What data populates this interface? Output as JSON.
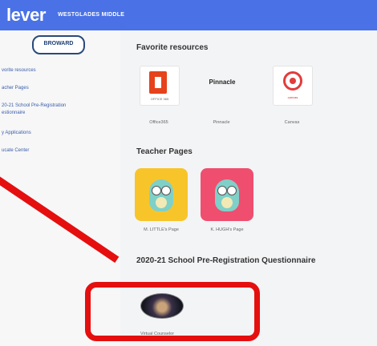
{
  "header": {
    "brand": "lever",
    "school": "WESTGLADES MIDDLE"
  },
  "sidebar": {
    "district_logo": "BROWARD",
    "items": [
      {
        "label": "vorite resources"
      },
      {
        "label": "acher Pages"
      },
      {
        "label": "20-21 School Pre-Registration\nestionnaire"
      },
      {
        "label": "y Applications"
      },
      {
        "label": "ucate Center"
      }
    ]
  },
  "main": {
    "favorites": {
      "title": "Favorite resources",
      "apps": [
        {
          "label": "Office365",
          "tile_text": "OFFICE 365",
          "icon": "office-icon"
        },
        {
          "label": "Pinnacle",
          "tile_text": "Pinnacle",
          "icon": "pinnacle-icon"
        },
        {
          "label": "Canvas",
          "tile_text": "canvas",
          "icon": "canvas-icon"
        }
      ]
    },
    "teacher_pages": {
      "title": "Teacher Pages",
      "pages": [
        {
          "label": "M. LITTLE's Page",
          "color": "#f7c52a",
          "icon": "owl-icon"
        },
        {
          "label": "K. HUGH's Page",
          "color": "#ef4e6f",
          "icon": "owl-icon"
        }
      ]
    },
    "questionnaire": {
      "title": "2020-21 School Pre-Registration Questionnaire",
      "app": {
        "label": "Virtual Counselor",
        "icon": "virtual-counselor-icon"
      }
    }
  },
  "annotation": {
    "color": "#e50f0f"
  }
}
